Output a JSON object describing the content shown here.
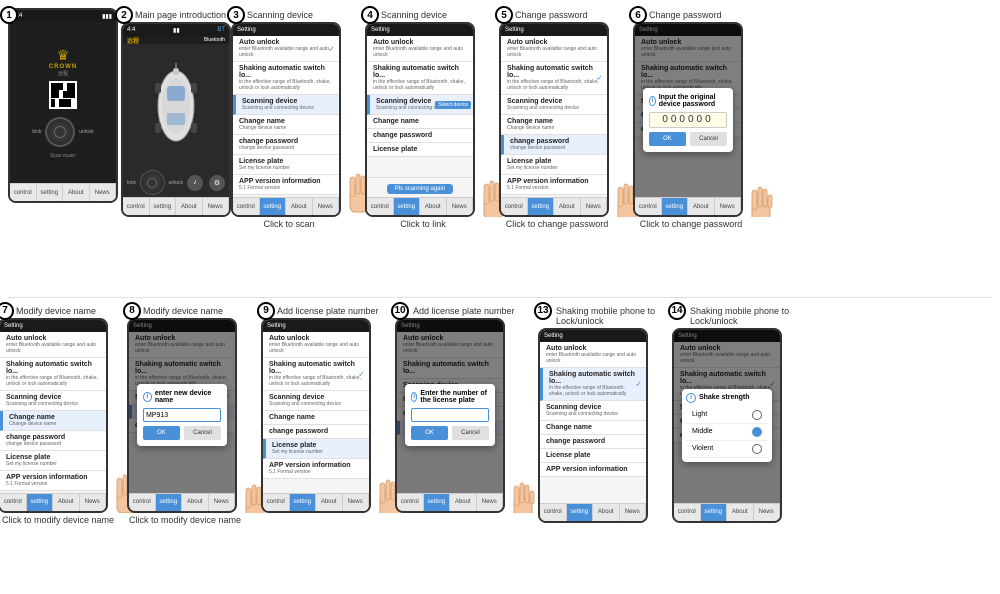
{
  "steps": [
    {
      "number": "1",
      "title": "",
      "label": "",
      "type": "main_page"
    },
    {
      "number": "2",
      "title": "Main page introduction",
      "label": "",
      "type": "main_intro"
    },
    {
      "number": "3",
      "title": "Scanning device",
      "label": "Click to scan",
      "type": "scanning"
    },
    {
      "number": "4",
      "title": "Scanning device",
      "label": "Click to link",
      "type": "scanning_link"
    },
    {
      "number": "5",
      "title": "Change password",
      "label": "Click to change password",
      "type": "change_pw"
    },
    {
      "number": "6",
      "title": "Change password",
      "label": "Click to change password",
      "type": "change_pw_dialog"
    },
    {
      "number": "7",
      "title": "Modify device name",
      "label": "Click to modify device name",
      "type": "modify_name"
    },
    {
      "number": "8",
      "title": "Modify device name",
      "label": "Click to modify device name",
      "type": "modify_name_dialog"
    },
    {
      "number": "9",
      "title": "Add license plate number",
      "label": "",
      "type": "license_plate"
    },
    {
      "number": "10",
      "title": "Add license plate number",
      "label": "",
      "type": "license_plate_dialog"
    },
    {
      "number": "13",
      "title": "Shaking mobile phone to Lock/unlock",
      "label": "",
      "type": "shake_lock"
    },
    {
      "number": "14",
      "title": "Shaking mobile phone to Lock/unlock",
      "label": "",
      "type": "shake_strength"
    }
  ],
  "settings": {
    "auto_unlock": "Auto unlock",
    "auto_unlock_desc": "enter Bluetooth available range and auto unlock",
    "shaking": "Shaking automatic switch lo...",
    "shaking_desc": "in the effective range of Bluetooth, shake, unlock or lock automatically",
    "scanning": "Scanning device",
    "scanning_desc": "Scanning and connecting device",
    "change_name": "Change name",
    "change_name_desc": "Change device name",
    "change_password": "change password",
    "change_password_desc": "change device password",
    "license_plate": "License plate",
    "license_plate_desc": "Set my license number",
    "app_version": "APP version information",
    "app_version_desc": "5.1 Formal version"
  },
  "tabs": {
    "control": "control",
    "setting": "setting",
    "about": "About",
    "news": "News"
  },
  "dialogs": {
    "change_password_title": "Input the original device password",
    "password_value": "000000",
    "ok": "OK",
    "cancel": "Cancel",
    "modify_name_title": "enter new device name",
    "modify_name_value": "MP913",
    "license_title": "Enter the number of the license plate",
    "scan_again": "Pls scanning again",
    "shake_strength_title": "Shake strength",
    "light": "Light",
    "middle": "Middle",
    "violent": "Violent"
  }
}
